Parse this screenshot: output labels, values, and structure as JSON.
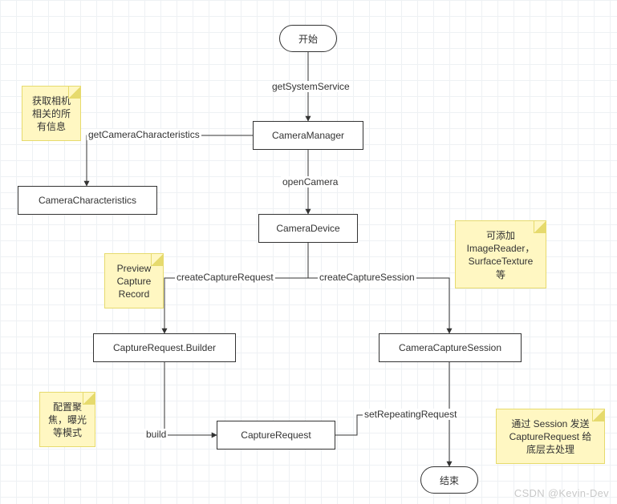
{
  "nodes": {
    "start": "开始",
    "cameraManager": "CameraManager",
    "cameraCharacteristics": "CameraCharacteristics",
    "cameraDevice": "CameraDevice",
    "captureRequestBuilder": "CaptureRequest.Builder",
    "cameraCaptureSession": "CameraCaptureSession",
    "captureRequest": "CaptureRequest",
    "end": "结束"
  },
  "edges": {
    "getSystemService": "getSystemService",
    "getCameraCharacteristics": "getCameraCharacteristics",
    "openCamera": "openCamera",
    "createCaptureRequest": "createCaptureRequest",
    "createCaptureSession": "createCaptureSession",
    "build": "build",
    "setRepeatingRequest": "setRepeatingRequest"
  },
  "notes": {
    "cameraInfo": "获取相机\n相关的所\n有信息",
    "previewCaptureRecord": "Preview\nCapture\nRecord",
    "addSurfaces": "可添加\nImageReader，\nSurfaceTexture\n等",
    "focusExposure": "配置聚\n焦，曝光\n等模式",
    "sessionSend": "通过 Session 发送\nCaptureRequest 给\n底层去处理"
  },
  "watermark": "CSDN @Kevin-Dev"
}
